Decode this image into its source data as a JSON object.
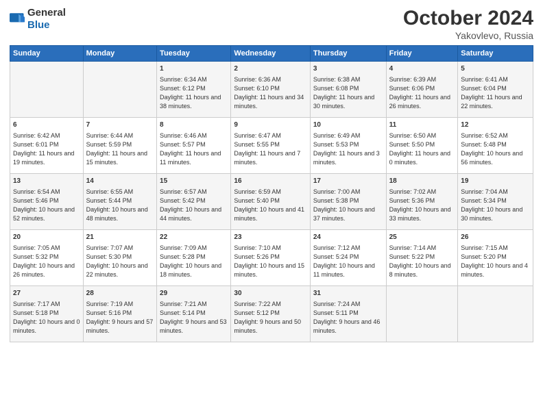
{
  "header": {
    "logo": {
      "general": "General",
      "blue": "Blue"
    },
    "month": "October 2024",
    "location": "Yakovlevo, Russia"
  },
  "days_of_week": [
    "Sunday",
    "Monday",
    "Tuesday",
    "Wednesday",
    "Thursday",
    "Friday",
    "Saturday"
  ],
  "weeks": [
    [
      {
        "day": "",
        "info": ""
      },
      {
        "day": "",
        "info": ""
      },
      {
        "day": "1",
        "info": "Sunrise: 6:34 AM\nSunset: 6:12 PM\nDaylight: 11 hours and 38 minutes."
      },
      {
        "day": "2",
        "info": "Sunrise: 6:36 AM\nSunset: 6:10 PM\nDaylight: 11 hours and 34 minutes."
      },
      {
        "day": "3",
        "info": "Sunrise: 6:38 AM\nSunset: 6:08 PM\nDaylight: 11 hours and 30 minutes."
      },
      {
        "day": "4",
        "info": "Sunrise: 6:39 AM\nSunset: 6:06 PM\nDaylight: 11 hours and 26 minutes."
      },
      {
        "day": "5",
        "info": "Sunrise: 6:41 AM\nSunset: 6:04 PM\nDaylight: 11 hours and 22 minutes."
      }
    ],
    [
      {
        "day": "6",
        "info": "Sunrise: 6:42 AM\nSunset: 6:01 PM\nDaylight: 11 hours and 19 minutes."
      },
      {
        "day": "7",
        "info": "Sunrise: 6:44 AM\nSunset: 5:59 PM\nDaylight: 11 hours and 15 minutes."
      },
      {
        "day": "8",
        "info": "Sunrise: 6:46 AM\nSunset: 5:57 PM\nDaylight: 11 hours and 11 minutes."
      },
      {
        "day": "9",
        "info": "Sunrise: 6:47 AM\nSunset: 5:55 PM\nDaylight: 11 hours and 7 minutes."
      },
      {
        "day": "10",
        "info": "Sunrise: 6:49 AM\nSunset: 5:53 PM\nDaylight: 11 hours and 3 minutes."
      },
      {
        "day": "11",
        "info": "Sunrise: 6:50 AM\nSunset: 5:50 PM\nDaylight: 11 hours and 0 minutes."
      },
      {
        "day": "12",
        "info": "Sunrise: 6:52 AM\nSunset: 5:48 PM\nDaylight: 10 hours and 56 minutes."
      }
    ],
    [
      {
        "day": "13",
        "info": "Sunrise: 6:54 AM\nSunset: 5:46 PM\nDaylight: 10 hours and 52 minutes."
      },
      {
        "day": "14",
        "info": "Sunrise: 6:55 AM\nSunset: 5:44 PM\nDaylight: 10 hours and 48 minutes."
      },
      {
        "day": "15",
        "info": "Sunrise: 6:57 AM\nSunset: 5:42 PM\nDaylight: 10 hours and 44 minutes."
      },
      {
        "day": "16",
        "info": "Sunrise: 6:59 AM\nSunset: 5:40 PM\nDaylight: 10 hours and 41 minutes."
      },
      {
        "day": "17",
        "info": "Sunrise: 7:00 AM\nSunset: 5:38 PM\nDaylight: 10 hours and 37 minutes."
      },
      {
        "day": "18",
        "info": "Sunrise: 7:02 AM\nSunset: 5:36 PM\nDaylight: 10 hours and 33 minutes."
      },
      {
        "day": "19",
        "info": "Sunrise: 7:04 AM\nSunset: 5:34 PM\nDaylight: 10 hours and 30 minutes."
      }
    ],
    [
      {
        "day": "20",
        "info": "Sunrise: 7:05 AM\nSunset: 5:32 PM\nDaylight: 10 hours and 26 minutes."
      },
      {
        "day": "21",
        "info": "Sunrise: 7:07 AM\nSunset: 5:30 PM\nDaylight: 10 hours and 22 minutes."
      },
      {
        "day": "22",
        "info": "Sunrise: 7:09 AM\nSunset: 5:28 PM\nDaylight: 10 hours and 18 minutes."
      },
      {
        "day": "23",
        "info": "Sunrise: 7:10 AM\nSunset: 5:26 PM\nDaylight: 10 hours and 15 minutes."
      },
      {
        "day": "24",
        "info": "Sunrise: 7:12 AM\nSunset: 5:24 PM\nDaylight: 10 hours and 11 minutes."
      },
      {
        "day": "25",
        "info": "Sunrise: 7:14 AM\nSunset: 5:22 PM\nDaylight: 10 hours and 8 minutes."
      },
      {
        "day": "26",
        "info": "Sunrise: 7:15 AM\nSunset: 5:20 PM\nDaylight: 10 hours and 4 minutes."
      }
    ],
    [
      {
        "day": "27",
        "info": "Sunrise: 7:17 AM\nSunset: 5:18 PM\nDaylight: 10 hours and 0 minutes."
      },
      {
        "day": "28",
        "info": "Sunrise: 7:19 AM\nSunset: 5:16 PM\nDaylight: 9 hours and 57 minutes."
      },
      {
        "day": "29",
        "info": "Sunrise: 7:21 AM\nSunset: 5:14 PM\nDaylight: 9 hours and 53 minutes."
      },
      {
        "day": "30",
        "info": "Sunrise: 7:22 AM\nSunset: 5:12 PM\nDaylight: 9 hours and 50 minutes."
      },
      {
        "day": "31",
        "info": "Sunrise: 7:24 AM\nSunset: 5:11 PM\nDaylight: 9 hours and 46 minutes."
      },
      {
        "day": "",
        "info": ""
      },
      {
        "day": "",
        "info": ""
      }
    ]
  ]
}
